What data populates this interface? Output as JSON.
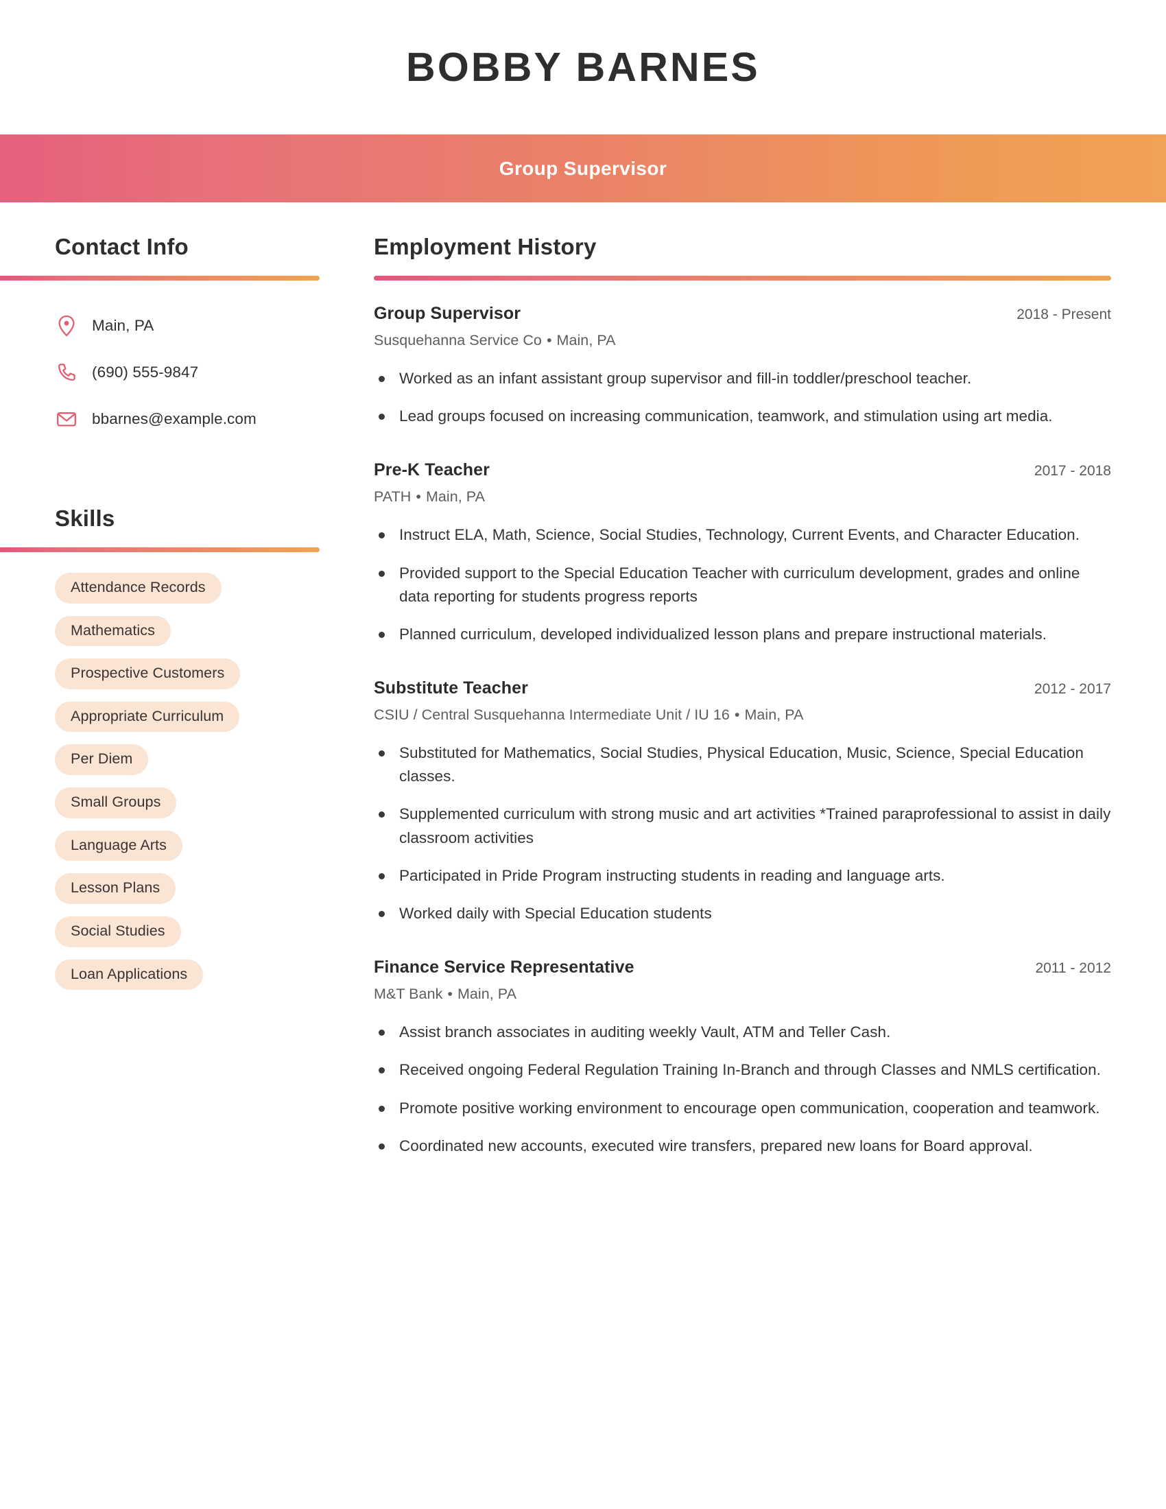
{
  "header": {
    "name": "BOBBY BARNES",
    "title": "Group Supervisor",
    "gradient_start": "#e4607c",
    "gradient_end": "#f0a255"
  },
  "sidebar": {
    "contact": {
      "heading": "Contact Info",
      "items": [
        {
          "icon": "location-pin-icon",
          "value": "Main, PA"
        },
        {
          "icon": "phone-icon",
          "value": "(690) 555-9847"
        },
        {
          "icon": "envelope-icon",
          "value": "bbarnes@example.com"
        }
      ]
    },
    "skills": {
      "heading": "Skills",
      "chip_background": "#fae4d4",
      "items": [
        "Attendance Records",
        "Mathematics",
        "Prospective Customers",
        "Appropriate Curriculum",
        "Per Diem",
        "Small Groups",
        "Language Arts",
        "Lesson Plans",
        "Social Studies",
        "Loan Applications"
      ]
    }
  },
  "main": {
    "employment": {
      "heading": "Employment History",
      "jobs": [
        {
          "title": "Group Supervisor",
          "dates": "2018 - Present",
          "company": "Susquehanna Service Co",
          "location": "Main, PA",
          "bullets": [
            "Worked as an infant assistant group supervisor and fill-in toddler/preschool teacher.",
            "Lead groups focused on increasing communication, teamwork, and stimulation using art media."
          ]
        },
        {
          "title": "Pre-K Teacher",
          "dates": "2017 - 2018",
          "company": "PATH",
          "location": "Main, PA",
          "bullets": [
            "Instruct ELA, Math, Science, Social Studies, Technology, Current Events, and Character Education.",
            "Provided support to the Special Education Teacher with curriculum development, grades and online data reporting for students progress reports",
            "Planned curriculum, developed individualized lesson plans and prepare instructional materials."
          ]
        },
        {
          "title": "Substitute Teacher",
          "dates": "2012 - 2017",
          "company": "CSIU / Central Susquehanna Intermediate Unit / IU 16",
          "location": "Main, PA",
          "bullets": [
            "Substituted for Mathematics, Social Studies, Physical Education, Music, Science, Special Education classes.",
            "Supplemented curriculum with strong music and art activities *Trained paraprofessional to assist in daily classroom activities",
            "Participated in Pride Program instructing students in reading and language arts.",
            "Worked daily with Special Education students"
          ]
        },
        {
          "title": "Finance Service Representative",
          "dates": "2011 - 2012",
          "company": "M&T Bank",
          "location": "Main, PA",
          "bullets": [
            "Assist branch associates in auditing weekly Vault, ATM and Teller Cash.",
            "Received ongoing Federal Regulation Training In-Branch and through Classes and NMLS certification.",
            "Promote positive working environment to encourage open communication, cooperation and teamwork.",
            "Coordinated new accounts, executed wire transfers, prepared new loans for Board approval."
          ]
        }
      ]
    }
  }
}
